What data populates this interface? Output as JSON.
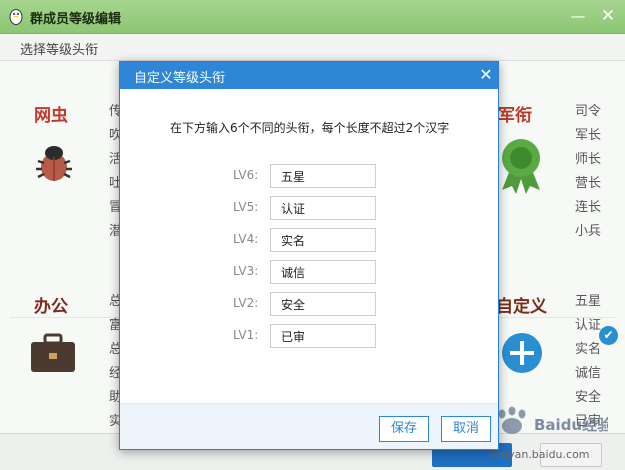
{
  "window": {
    "title": "群成员等级编辑",
    "min_glyph": "—",
    "close_glyph": "✕"
  },
  "tabbar": {
    "select_label": "选择等级头衔"
  },
  "categories": {
    "bug": {
      "title": "网虫",
      "title_color": "#c0392b",
      "ranks": [
        "传",
        "吹",
        "活",
        "吐",
        "冒",
        "潜"
      ]
    },
    "military": {
      "title": "军衔",
      "title_color": "#c0392b",
      "ranks": [
        "司令",
        "军长",
        "师长",
        "营长",
        "连长",
        "小兵"
      ]
    },
    "office": {
      "title": "办公",
      "title_color": "#7a2b1a",
      "ranks": [
        "总",
        "富",
        "总",
        "经",
        "助",
        "实"
      ]
    },
    "custom": {
      "title": "自定义",
      "title_color": "#7a2b1a",
      "ranks": [
        "五星",
        "认证",
        "实名",
        "诚信",
        "安全",
        "已审"
      ]
    }
  },
  "dialog": {
    "title": "自定义等级头衔",
    "close_glyph": "✕",
    "instruction": "在下方输入6个不同的头衔，每个长度不超过2个汉字",
    "levels": [
      {
        "label": "LV6:",
        "value": "五星"
      },
      {
        "label": "LV5:",
        "value": "认证"
      },
      {
        "label": "LV4:",
        "value": "实名"
      },
      {
        "label": "LV3:",
        "value": "诚信"
      },
      {
        "label": "LV2:",
        "value": "安全"
      },
      {
        "label": "LV1:",
        "value": "已审"
      }
    ],
    "save_label": "保存",
    "cancel_label": "取消"
  },
  "watermark": {
    "text": "jingyan.baidu.com",
    "logo_text": "Baidu经验"
  },
  "colors": {
    "accent": "#2f86d6",
    "titlebar": "#8cc673",
    "checkmark": "#2a8fd0"
  },
  "icons": [
    "qq-penguin-icon",
    "bug-icon",
    "medal-icon",
    "briefcase-icon",
    "plus-circle-icon",
    "check-circle-icon",
    "close-icon",
    "minimize-icon"
  ]
}
